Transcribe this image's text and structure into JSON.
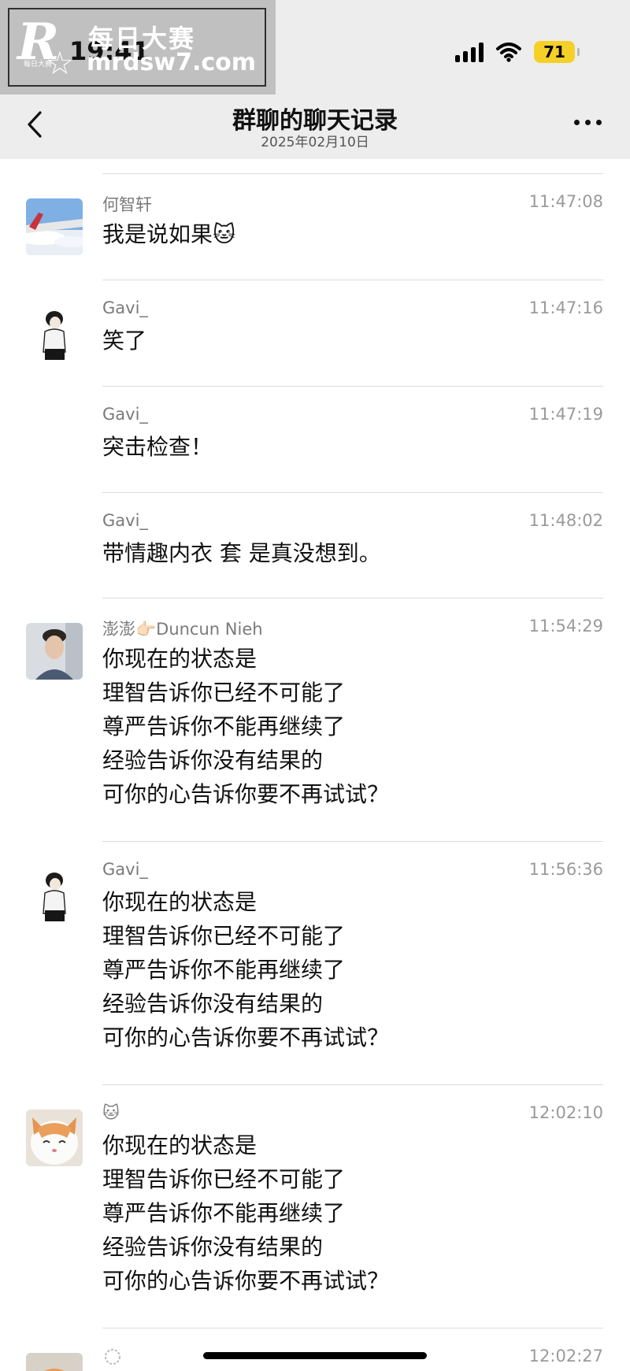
{
  "status_bar": {
    "time": "19:41",
    "battery_level": "71"
  },
  "watermark": {
    "logo": "R",
    "small_text": "每日大赛",
    "chinese": "每日大赛",
    "url": "mrdsw7.com"
  },
  "nav": {
    "title": "群聊的聊天记录",
    "date": "2025年02月10日"
  },
  "messages": [
    {
      "sender": "何智轩",
      "time": "11:47:08",
      "lines": [
        "我是说如果🐱"
      ],
      "avatar": "airplane-wing"
    },
    {
      "sender": "Gavi_",
      "time": "11:47:16",
      "lines": [
        "笑了"
      ],
      "avatar": "man-sketch"
    },
    {
      "sender": "Gavi_",
      "time": "11:47:19",
      "lines": [
        "突击检查！"
      ],
      "avatar": ""
    },
    {
      "sender": "Gavi_",
      "time": "11:48:02",
      "lines": [
        "带情趣内衣 套  是真没想到。"
      ],
      "avatar": ""
    },
    {
      "sender": "澎澎👉🏻Duncun Nieh",
      "time": "11:54:29",
      "lines": [
        "你现在的状态是",
        "理智告诉你已经不可能了",
        "尊严告诉你不能再继续了",
        "经验告诉你没有结果的",
        "可你的心告诉你要不再试试？"
      ],
      "avatar": "young-man-photo"
    },
    {
      "sender": "Gavi_",
      "time": "11:56:36",
      "lines": [
        "你现在的状态是",
        "理智告诉你已经不可能了",
        "尊严告诉你不能再继续了",
        "经验告诉你没有结果的",
        "可你的心告诉你要不再试试？"
      ],
      "avatar": "man-sketch"
    },
    {
      "sender": "🐱",
      "time": "12:02:10",
      "lines": [
        "你现在的状态是",
        "理智告诉你已经不可能了",
        "尊严告诉你不能再继续了",
        "经验告诉你没有结果的",
        "可你的心告诉你要不再试试？"
      ],
      "avatar": "cat-photo"
    },
    {
      "sender": "",
      "time": "12:02:27",
      "lines": [],
      "avatar": "cat-photo-2"
    }
  ]
}
